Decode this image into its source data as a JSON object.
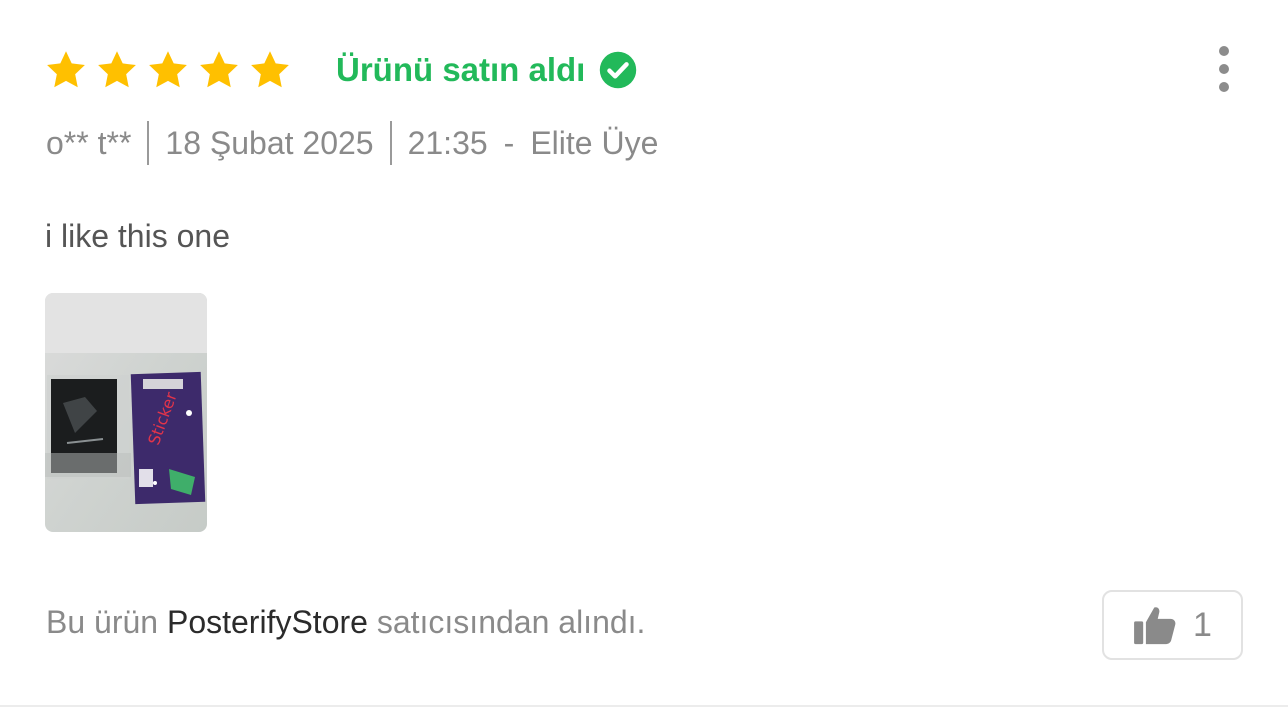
{
  "review": {
    "rating": 5,
    "rating_max": 5,
    "star_color": "#ffc000",
    "verified_label": "Ürünü satın aldı",
    "verified_color": "#22b95a",
    "verified_icon": "check-circle-icon",
    "more_icon": "more-vertical-icon",
    "author": "o** t**",
    "date": "18 Şubat 2025",
    "time": "21:35",
    "dash": "-",
    "membership": "Elite Üye",
    "comment": "i like this one",
    "photo_count": 1,
    "seller": {
      "prefix": "Bu ürün ",
      "name": "PosterifyStore",
      "suffix": " satıcısından alındı."
    },
    "like": {
      "icon": "thumbs-up-icon",
      "count": "1"
    }
  }
}
